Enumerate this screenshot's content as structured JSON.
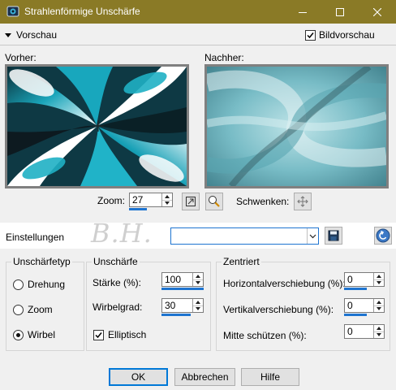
{
  "window": {
    "title": "Strahlenförmige Unschärfe",
    "titlebar_color": "#8a7a26"
  },
  "preview": {
    "toggle_label": "Vorschau",
    "bildvorschau_label": "Bildvorschau",
    "bildvorschau_checked": true,
    "before_label": "Vorher:",
    "after_label": "Nachher:"
  },
  "zoom": {
    "label": "Zoom:",
    "value": "27",
    "pan_label": "Schwenken:"
  },
  "settings": {
    "label": "Einstellungen",
    "preset_value": "",
    "watermark": "B.H."
  },
  "blur_type": {
    "title": "Unschärfetyp",
    "options": [
      {
        "label": "Drehung",
        "selected": false
      },
      {
        "label": "Zoom",
        "selected": false
      },
      {
        "label": "Wirbel",
        "selected": true
      }
    ]
  },
  "blur": {
    "title": "Unschärfe",
    "strength_label": "Stärke (%):",
    "strength_value": "100",
    "twist_label": "Wirbelgrad:",
    "twist_value": "30",
    "elliptical_label": "Elliptisch",
    "elliptical_checked": true
  },
  "center": {
    "title": "Zentriert",
    "h_offset_label": "Horizontalverschiebung (%):",
    "h_offset_value": "0",
    "v_offset_label": "Vertikalverschiebung (%):",
    "v_offset_value": "0",
    "protect_label": "Mitte schützen (%):",
    "protect_value": "0"
  },
  "buttons": {
    "ok": "OK",
    "cancel": "Abbrechen",
    "help": "Hilfe"
  },
  "colors": {
    "accent": "#1e74d0",
    "teal": "#1ea5b8"
  }
}
